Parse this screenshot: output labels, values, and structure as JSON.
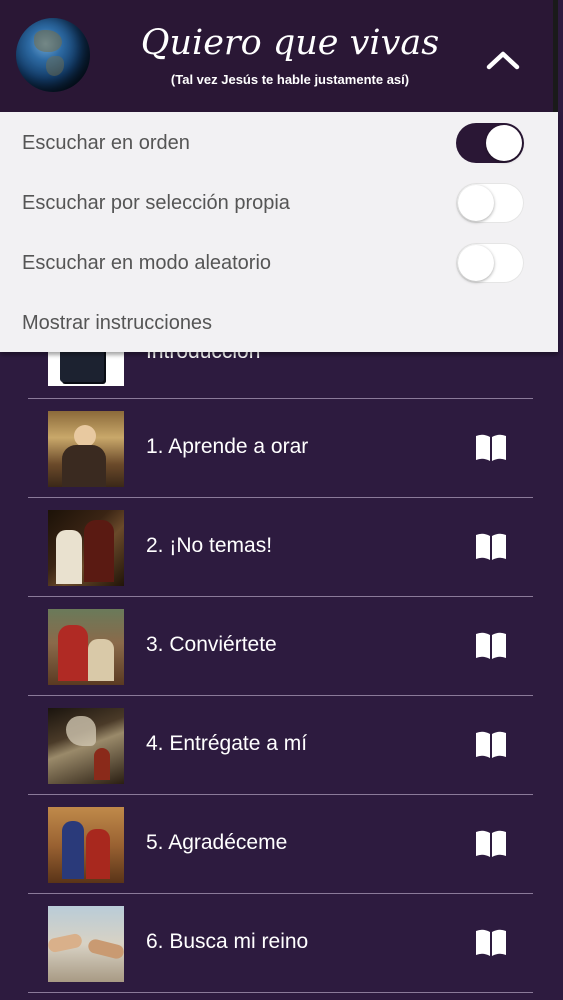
{
  "header": {
    "title": "Quiero que vivas",
    "subtitle": "(Tal vez Jesús te hable justamente así)",
    "logo_icon": "globe-icon",
    "collapse_icon": "chevron-up-icon"
  },
  "menu": {
    "options": [
      {
        "label": "Escuchar en orden",
        "toggle": true
      },
      {
        "label": "Escuchar por selección propia",
        "toggle": false
      },
      {
        "label": "Escuchar en modo aleatorio",
        "toggle": false
      }
    ],
    "instructions_label": "Mostrar instrucciones"
  },
  "list": {
    "items": [
      {
        "label": "Introducción",
        "icon": "bible-thumbnail"
      },
      {
        "label": "1. Aprende a orar",
        "icon": "book-icon"
      },
      {
        "label": "2. ¡No temas!",
        "icon": "book-icon"
      },
      {
        "label": "3. Conviértete",
        "icon": "book-icon"
      },
      {
        "label": "4. Entrégate a mí",
        "icon": "book-icon"
      },
      {
        "label": "5. Agradéceme",
        "icon": "book-icon"
      },
      {
        "label": "6. Busca mi reino",
        "icon": "book-icon"
      }
    ]
  },
  "colors": {
    "header_bg": "#2a1735",
    "list_bg": "#2d1b3f",
    "panel_bg": "#f2f1f3",
    "toggle_on": "#2a1735"
  }
}
